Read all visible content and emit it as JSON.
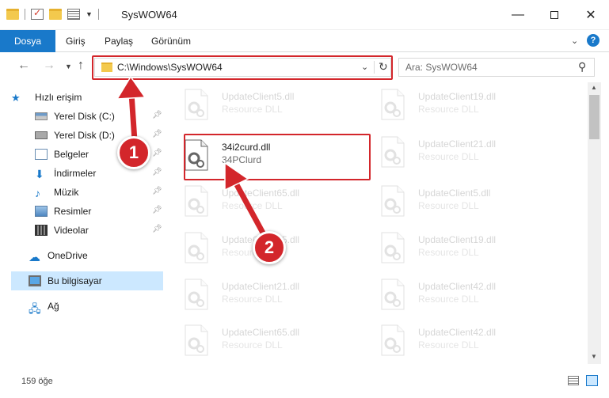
{
  "window": {
    "title": "SysWOW64",
    "controls": {
      "minimize": "—",
      "maximize": "",
      "close": "✕"
    }
  },
  "ribbon": {
    "tabs": [
      {
        "label": "Dosya",
        "active": true
      },
      {
        "label": "Giriş"
      },
      {
        "label": "Paylaş"
      },
      {
        "label": "Görünüm"
      }
    ],
    "help": "?"
  },
  "navigation": {
    "address": "C:\\Windows\\SysWOW64",
    "search_placeholder": "Ara: SysWOW64"
  },
  "sidebar": {
    "quick_access": "Hızlı erişim",
    "items": [
      {
        "label": "Yerel Disk (C:)",
        "icon": "drive-icon",
        "pinned": true
      },
      {
        "label": "Yerel Disk (D:)",
        "icon": "drive-icon",
        "pinned": true
      },
      {
        "label": "Belgeler",
        "icon": "documents-icon",
        "pinned": true
      },
      {
        "label": "İndirmeler",
        "icon": "downloads-icon",
        "pinned": true
      },
      {
        "label": "Müzik",
        "icon": "music-icon",
        "pinned": true
      },
      {
        "label": "Resimler",
        "icon": "pictures-icon",
        "pinned": true
      },
      {
        "label": "Videolar",
        "icon": "videos-icon",
        "pinned": true
      }
    ],
    "onedrive": "OneDrive",
    "this_pc": "Bu bilgisayar",
    "network": "Ağ"
  },
  "files": {
    "highlighted": {
      "name": "34i2curd.dll",
      "description": "34PClurd"
    },
    "col1": [
      {
        "name": "UpdateClient5.dll",
        "description": "Resource DLL"
      },
      {
        "name": "UpdateClient65.dll",
        "description": "Resource DLL"
      },
      {
        "name": "UpdateClient65.dll",
        "description": "Resource DLL"
      },
      {
        "name": "UpdateClient21.dll",
        "description": "Resource DLL"
      },
      {
        "name": "UpdateClient65.dll",
        "description": "Resource DLL"
      }
    ],
    "col2": [
      {
        "name": "UpdateClient19.dll",
        "description": "Resource DLL"
      },
      {
        "name": "UpdateClient21.dll",
        "description": "Resource DLL"
      },
      {
        "name": "UpdateClient5.dll",
        "description": "Resource DLL"
      },
      {
        "name": "UpdateClient19.dll",
        "description": "Resource DLL"
      },
      {
        "name": "UpdateClient42.dll",
        "description": "Resource DLL"
      },
      {
        "name": "UpdateClient42.dll",
        "description": "Resource DLL"
      }
    ]
  },
  "status": {
    "item_count": "159 öğe"
  },
  "annotations": {
    "step1": "1",
    "step2": "2",
    "color": "#d3262b"
  },
  "colors": {
    "accent": "#1979ca",
    "selection": "#cce8ff",
    "highlight": "#d3262b"
  }
}
